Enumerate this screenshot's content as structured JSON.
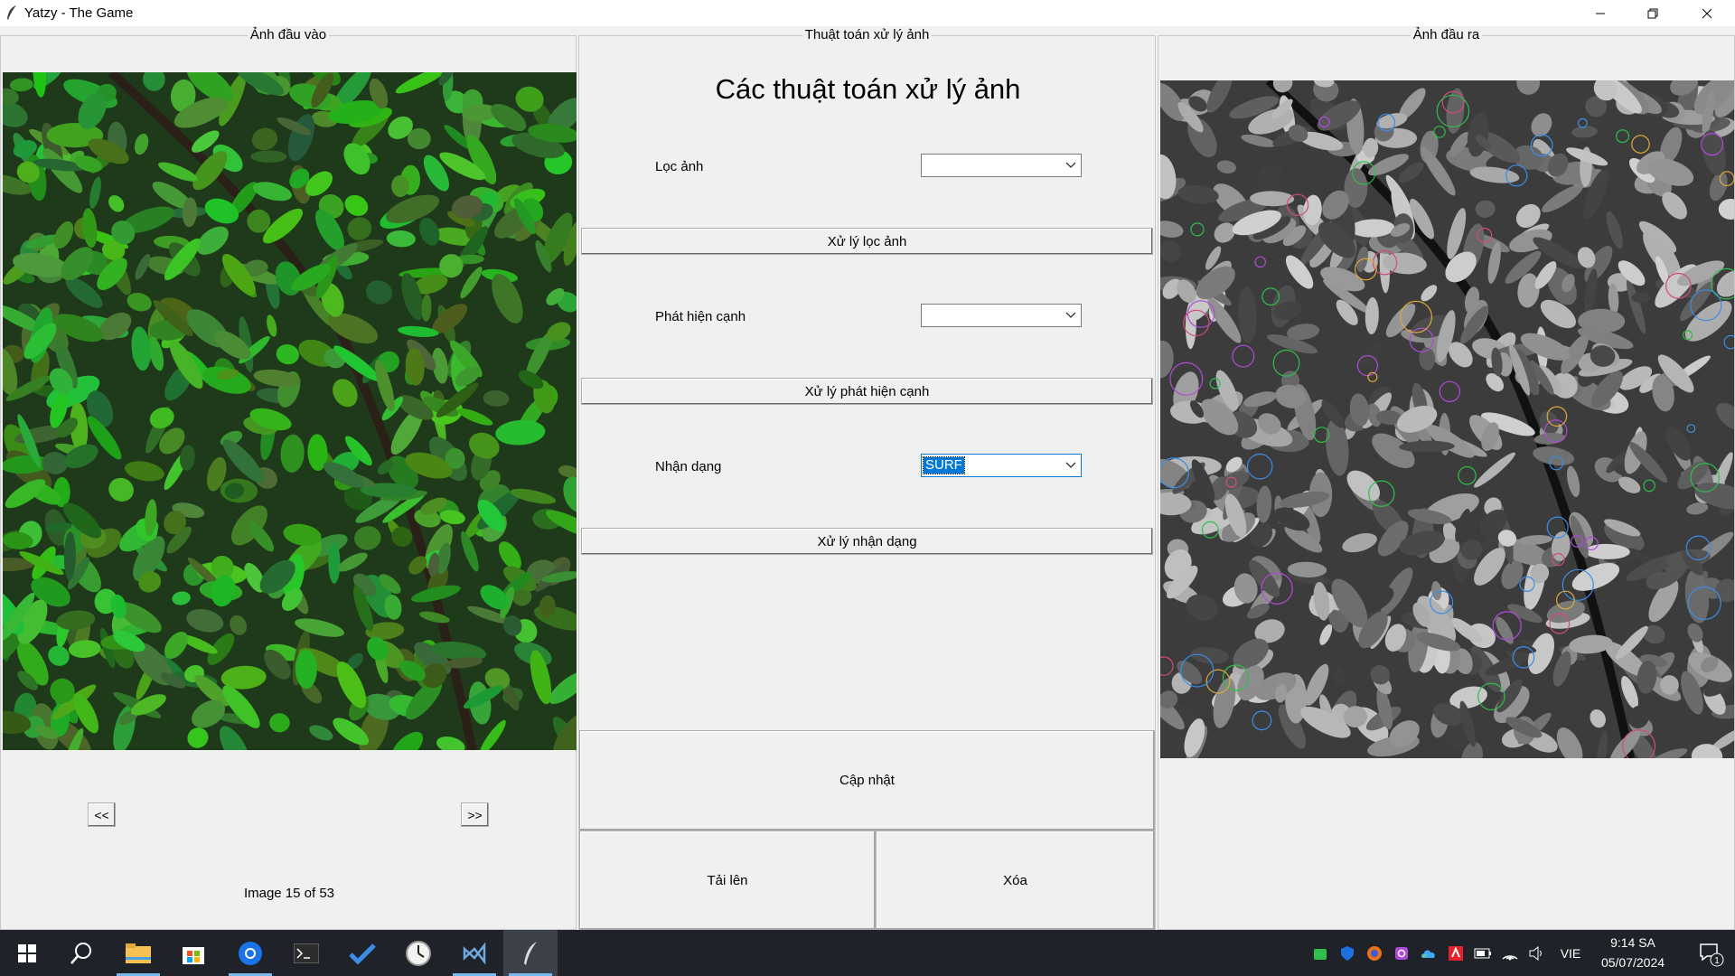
{
  "window": {
    "title": "Yatzy - The Game"
  },
  "left_panel": {
    "title": "Ảnh đầu vào",
    "prev_label": "<<",
    "next_label": ">>",
    "counter": "Image 15 of 53"
  },
  "middle_panel": {
    "title": "Thuật toán xử lý ảnh",
    "heading": "Các thuật toán xử lý ảnh",
    "filter": {
      "label": "Lọc ảnh",
      "value": "",
      "button": "Xử lý lọc ảnh"
    },
    "edge": {
      "label": "Phát hiện cạnh",
      "value": "",
      "button": "Xử lý phát hiện cạnh"
    },
    "recognition": {
      "label": "Nhận dạng",
      "value": "SURF",
      "button": "Xử lý nhận dạng"
    },
    "update_button": "Cập nhật",
    "upload_button": "Tải lên",
    "delete_button": "Xóa"
  },
  "right_panel": {
    "title": "Ảnh đầu ra"
  },
  "taskbar": {
    "icons": [
      "windows-start-icon",
      "search-icon",
      "file-explorer-icon",
      "microsoft-store-icon",
      "browser-icon",
      "terminal-icon",
      "todo-icon",
      "clock-app-icon",
      "vscode-icon",
      "feather-app-icon"
    ],
    "language": "VIE",
    "time": "9:14 SA",
    "date": "05/07/2024",
    "notification_count": "1"
  },
  "colors": {
    "accent": "#0078d7",
    "taskbar": "#1f2329",
    "panel_bg": "#f0f0f0"
  }
}
